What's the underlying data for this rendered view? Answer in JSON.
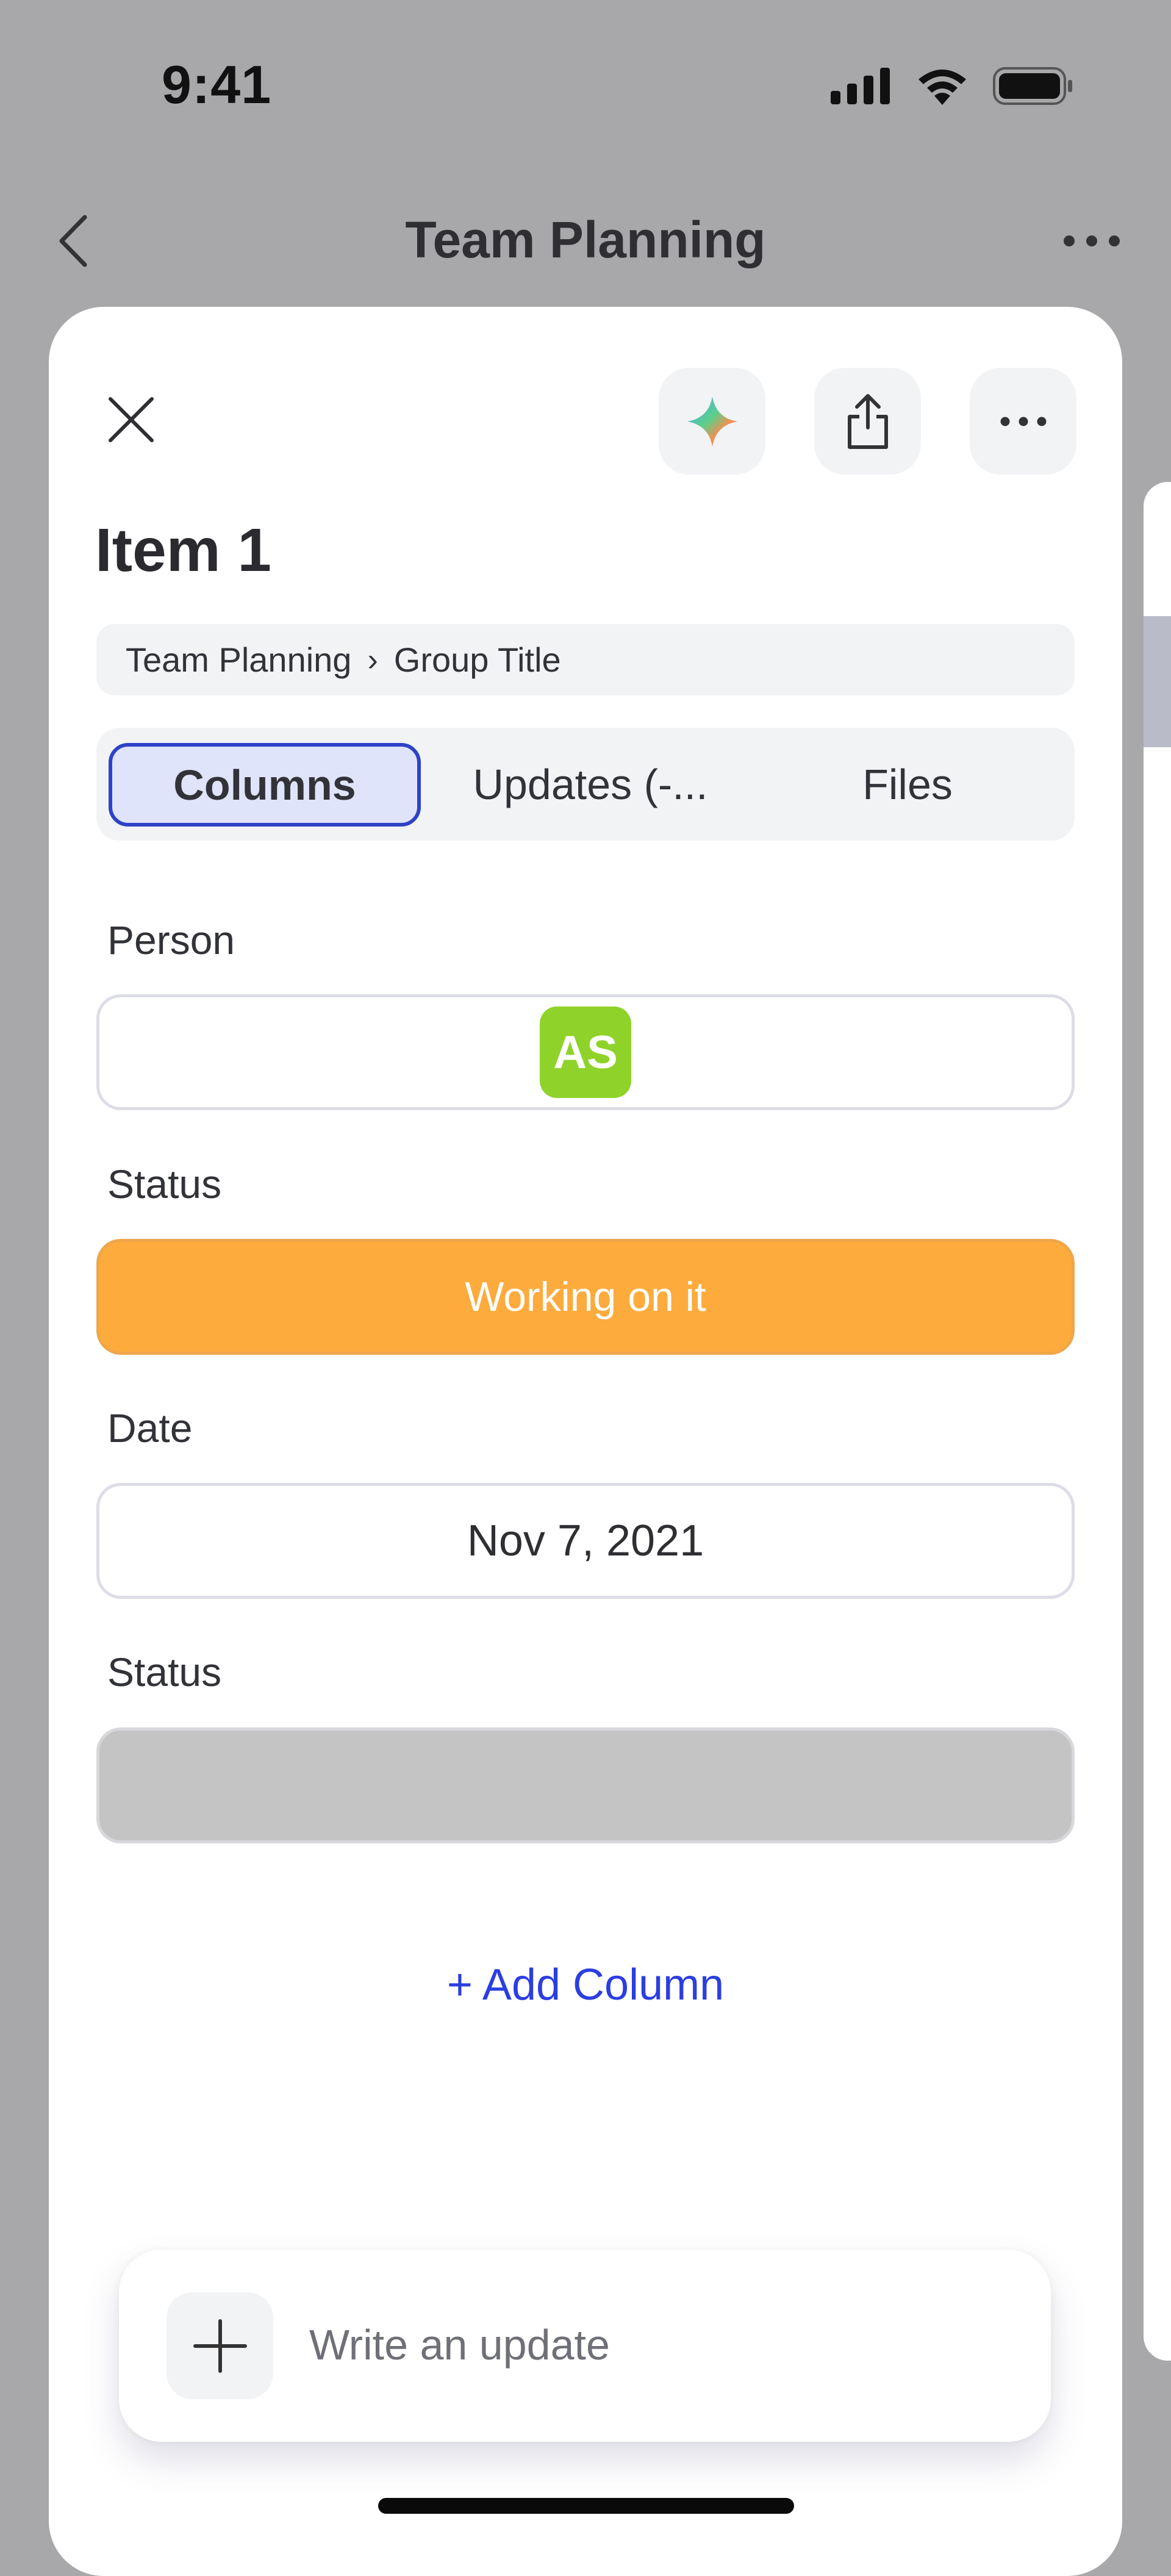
{
  "status_bar": {
    "time": "9:41"
  },
  "nav": {
    "title": "Team Planning"
  },
  "item": {
    "title": "Item 1",
    "breadcrumb": {
      "board": "Team Planning",
      "group": "Group Title"
    }
  },
  "tabs": [
    {
      "label": "Columns",
      "active": true
    },
    {
      "label": "Updates (-...",
      "active": false
    },
    {
      "label": "Files",
      "active": false
    }
  ],
  "fields": {
    "person": {
      "label": "Person",
      "avatar_initials": "AS",
      "avatar_color": "#8fd32a"
    },
    "status": {
      "label": "Status",
      "value": "Working on it",
      "color": "#fdab3d"
    },
    "date": {
      "label": "Date",
      "value": "Nov 7, 2021"
    },
    "status2": {
      "label": "Status",
      "value": "",
      "color": "#c4c4c4"
    }
  },
  "add_column_label": "+ Add Column",
  "composer": {
    "placeholder": "Write an update"
  },
  "colors": {
    "accent": "#2e42c8",
    "link": "#2b3ee0"
  }
}
